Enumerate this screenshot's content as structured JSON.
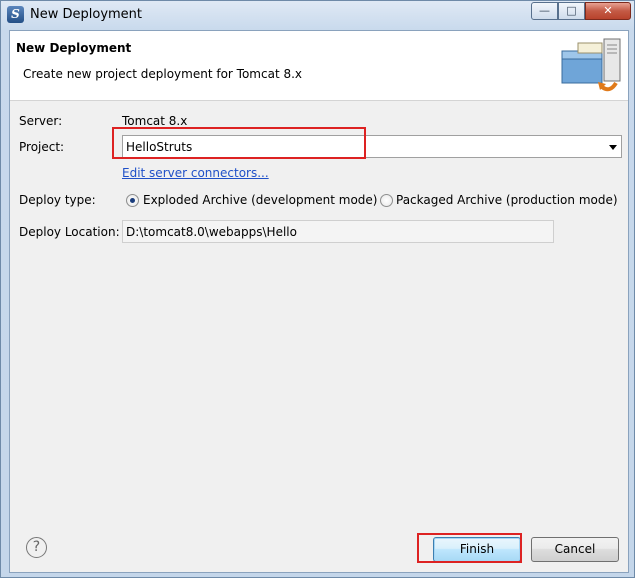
{
  "window": {
    "title": "New Deployment",
    "icon_letter": "S",
    "controls": {
      "minimize": "—",
      "maximize": "□",
      "close": "✕"
    }
  },
  "header": {
    "title": "New Deployment",
    "description": "Create new project deployment for Tomcat  8.x"
  },
  "form": {
    "server_label": "Server:",
    "server_value": "Tomcat  8.x",
    "project_label": "Project:",
    "project_value": "HelloStruts",
    "edit_connectors_link": "Edit server connectors...",
    "deploy_type_label": "Deploy type:",
    "deploy_types": [
      {
        "label": "Exploded Archive (development mode)",
        "selected": true
      },
      {
        "label": "Packaged Archive (production mode)",
        "selected": false
      }
    ],
    "deploy_location_label": "Deploy Location:",
    "deploy_location_value": "D:\\tomcat8.0\\webapps\\Hello"
  },
  "footer": {
    "help_symbol": "?",
    "finish_label": "Finish",
    "cancel_label": "Cancel"
  },
  "colors": {
    "highlight": "#dd2222",
    "link": "#1f50c8"
  }
}
